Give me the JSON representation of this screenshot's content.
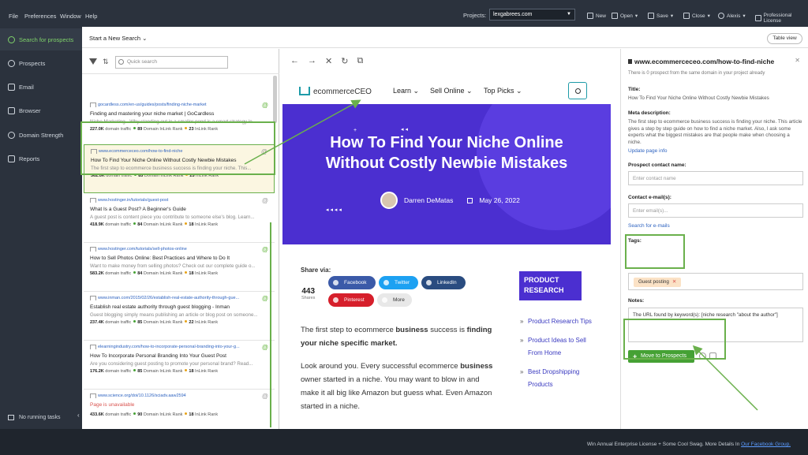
{
  "menu": [
    "File",
    "Preferences",
    "Window",
    "Help"
  ],
  "projects": {
    "label": "Projects:",
    "value": "lexgabrees.com"
  },
  "toolbar": [
    "New",
    "Open",
    "Save",
    "Close",
    "Alexis",
    "Professional License"
  ],
  "sidebar": {
    "items": [
      {
        "label": "Search for prospects",
        "icon": "search-icon"
      },
      {
        "label": "Prospects",
        "icon": "person-icon"
      },
      {
        "label": "Email",
        "icon": "mail-icon"
      },
      {
        "label": "Browser",
        "icon": "browser-icon"
      },
      {
        "label": "Domain Strength",
        "icon": "gauge-icon"
      },
      {
        "label": "Reports",
        "icon": "report-icon"
      }
    ],
    "running": "No running tasks"
  },
  "main": {
    "start_search": "Start a New Search",
    "table_view": "Table view"
  },
  "list": {
    "quick_search_placeholder": "Quick search",
    "rows": [
      {
        "url": "gocardless.com/en-us/guides/posts/finding-niche-market",
        "title": "Finding and mastering your niche market | GoCardless",
        "desc": "Niche Marketing - Why standing out in a smaller pond is a smart strategy in...",
        "traffic": "227.0K",
        "dt": "domain traffic",
        "dr": "89",
        "drl": "Domain InLink Rank",
        "ir": "23",
        "irl": "InLink Rank"
      },
      {
        "url": "www.ecommerceceo.com/how-to-find-niche",
        "title": "How To Find Your Niche Online Without Costly Newbie Mistakes",
        "desc": "The first step to ecommerce business success is finding your niche. This...",
        "traffic": "362.0K",
        "dt": "domain traffic",
        "dr": "85",
        "drl": "Domain InLink Rank",
        "ir": "25",
        "irl": "InLink Rank"
      },
      {
        "url": "www.hostinger.in/tutorials/guest-post",
        "title": "What Is a Guest Post? A Beginner's Guide",
        "desc": "A guest post is content piece you contribute to someone else's blog. Learn...",
        "traffic": "418.9K",
        "dt": "domain traffic",
        "dr": "84",
        "drl": "Domain InLink Rank",
        "ir": "18",
        "irl": "InLink Rank"
      },
      {
        "url": "www.hostinger.com/tutorials/sell-photos-online",
        "title": "How to Sell Photos Online: Best Practices and Where to Do It",
        "desc": "Want to make money from selling photos? Check out our complete guide o...",
        "traffic": "583.2K",
        "dt": "domain traffic",
        "dr": "84",
        "drl": "Domain InLink Rank",
        "ir": "18",
        "irl": "InLink Rank"
      },
      {
        "url": "www.inman.com/2015/02/26/establish-real-estate-authority-through-gue...",
        "title": "Establish real estate authority through guest blogging - Inman",
        "desc": "Guest blogging simply means publishing an article or blog post on someone...",
        "traffic": "237.4K",
        "dt": "domain traffic",
        "dr": "85",
        "drl": "Domain InLink Rank",
        "ir": "22",
        "irl": "InLink Rank"
      },
      {
        "url": "elearningindustry.com/how-to-incorporate-personal-branding-into-your-g...",
        "title": "How To Incorporate Personal Branding Into Your Guest Post",
        "desc": "Are you considering guest posting to promote your personal brand? Read...",
        "traffic": "176.2K",
        "dt": "domain traffic",
        "dr": "85",
        "drl": "Domain InLink Rank",
        "ir": "18",
        "irl": "InLink Rank"
      },
      {
        "url": "www.science.org/doi/10.1126/sciadv.aaw2594",
        "title": "Page is unavailable",
        "desc": "",
        "traffic": "433.6K",
        "dt": "domain traffic",
        "dr": "90",
        "drl": "Domain InLink Rank",
        "ir": "18",
        "irl": "InLink Rank"
      }
    ]
  },
  "page": {
    "logo": "ecommerceCEO",
    "nav": [
      "Learn",
      "Sell Online",
      "Top Picks"
    ],
    "title_line1": "How To Find Your Niche Online",
    "title_line2": "Without Costly Newbie Mistakes",
    "author": "Darren DeMatas",
    "date": "May 26, 2022",
    "share_label": "Share via:",
    "share_count": "443",
    "shares_word": "Shares",
    "share_buttons": [
      "Facebook",
      "Twitter",
      "LinkedIn",
      "Pinterest",
      "More"
    ],
    "product_research": "PRODUCT RESEARCH",
    "product_links": [
      "Product Research Tips",
      "Product Ideas to Sell From Home",
      "Best Dropshipping Products"
    ],
    "para1_a": "The first step to ecommerce ",
    "para1_b": "business",
    "para1_c": " success is ",
    "para1_d": "finding your niche specific market.",
    "para2_a": "Look around you. Every successful ecommerce ",
    "para2_b": "business",
    "para2_c": " owner started in a niche. You may want to blow in and make it all big like Amazon but guess what. Even Amazon started in a niche."
  },
  "detail": {
    "url": "www.ecommerceceo.com/how-to-find-niche",
    "sub": "There is 0 prospect from the same domain in your project already",
    "title_label": "Title:",
    "title": "How To Find Your Niche Online Without Costly Newbie Mistakes",
    "meta_label": "Meta description:",
    "meta": "The first step to ecommerce business success is finding your niche. This article gives a step by step guide on how to find a niche market. Also, I ask some experts what the biggest mistakes are that people make when choosing a niche.",
    "update": "Update page info",
    "contact_label": "Prospect contact name:",
    "contact_ph": "Enter contact name",
    "email_label": "Contact e-mail(s):",
    "email_ph": "Enter email(s)...",
    "search_emails": "Search for e-mails",
    "tags_label": "Tags:",
    "tag": "Guest posting",
    "notes_label": "Notes:",
    "notes": "The URL found by keyword(s): [niche research \"about the author\"]",
    "move": "Move to Prospects"
  },
  "footer": {
    "text": "Win Annual Enterprise License + Some Cool Swag. More Details In ",
    "link": "Our Facebook Group."
  },
  "colors": {
    "accent": "#6ab04c",
    "hero": "#4b2fd0",
    "sidebar": "#2b323d"
  }
}
